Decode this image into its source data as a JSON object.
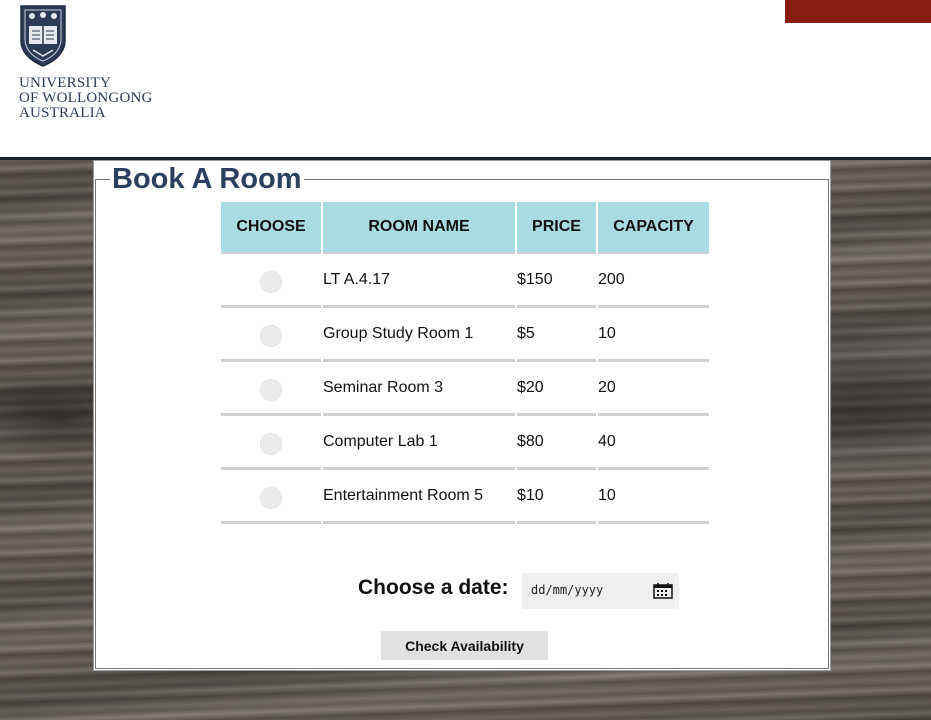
{
  "header": {
    "logo_lines": [
      "UNIVERSITY",
      "OF WOLLONGONG",
      "AUSTRALIA"
    ],
    "logo_icon": "university-crest-icon",
    "accent_color": "#8a1c12"
  },
  "form": {
    "title": "Book A Room",
    "columns": [
      "CHOOSE",
      "ROOM NAME",
      "PRICE",
      "CAPACITY"
    ],
    "rows": [
      {
        "name": "LT A.4.17",
        "price": "$150",
        "capacity": "200",
        "selected": false
      },
      {
        "name": "Group Study Room 1",
        "price": "$5",
        "capacity": "10",
        "selected": false
      },
      {
        "name": "Seminar Room 3",
        "price": "$20",
        "capacity": "20",
        "selected": false
      },
      {
        "name": "Computer Lab 1",
        "price": "$80",
        "capacity": "40",
        "selected": false
      },
      {
        "name": "Entertainment Room 5",
        "price": "$10",
        "capacity": "10",
        "selected": false
      }
    ],
    "date_label": "Choose a date:",
    "date_placeholder": "dd/mm/yyyy",
    "date_icon": "calendar-icon",
    "submit_label": "Check Availability",
    "header_color": "#a9dbe3",
    "title_color": "#2b3f5e"
  }
}
